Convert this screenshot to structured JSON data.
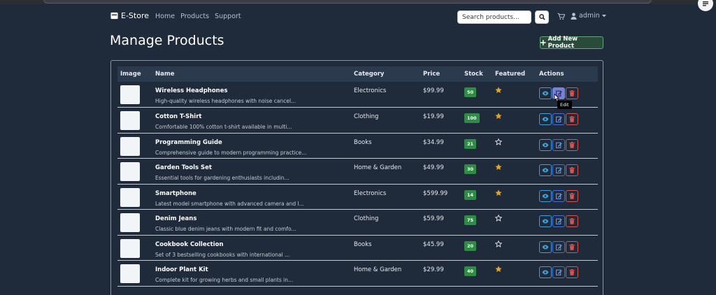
{
  "nav": {
    "brand": "E-Store",
    "links": [
      "Home",
      "Products",
      "Support"
    ],
    "search_placeholder": "Search products...",
    "user": "admin"
  },
  "page": {
    "title": "Manage Products",
    "add_label": "Add New Product",
    "tooltip": "Edit"
  },
  "table": {
    "headers": [
      "Image",
      "Name",
      "Category",
      "Price",
      "Stock",
      "Featured",
      "Actions"
    ],
    "rows": [
      {
        "name": "Wireless Headphones",
        "desc": "High-quality wireless headphones with noise cancel...",
        "category": "Electronics",
        "price": "$99.99",
        "stock": "50",
        "featured": true
      },
      {
        "name": "Cotton T-Shirt",
        "desc": "Comfortable 100% cotton t-shirt available in multi...",
        "category": "Clothing",
        "price": "$19.99",
        "stock": "100",
        "featured": true
      },
      {
        "name": "Programming Guide",
        "desc": "Comprehensive guide to modern programming practice...",
        "category": "Books",
        "price": "$34.99",
        "stock": "21",
        "featured": false
      },
      {
        "name": "Garden Tools Set",
        "desc": "Essential tools for gardening enthusiasts includin...",
        "category": "Home & Garden",
        "price": "$49.99",
        "stock": "30",
        "featured": true
      },
      {
        "name": "Smartphone",
        "desc": "Latest model smartphone with advanced camera and l...",
        "category": "Electronics",
        "price": "$599.99",
        "stock": "14",
        "featured": true
      },
      {
        "name": "Denim Jeans",
        "desc": "Classic blue denim jeans with modern fit and comfo...",
        "category": "Clothing",
        "price": "$59.99",
        "stock": "75",
        "featured": false
      },
      {
        "name": "Cookbook Collection",
        "desc": "Set of 3 bestselling cookbooks with international ...",
        "category": "Books",
        "price": "$45.99",
        "stock": "20",
        "featured": false
      },
      {
        "name": "Indoor Plant Kit",
        "desc": "Complete kit for growing herbs and small plants in...",
        "category": "Home & Garden",
        "price": "$29.99",
        "stock": "40",
        "featured": true
      }
    ]
  },
  "colors": {
    "background": "#1f2a3a",
    "header_row": "#2c3a4d",
    "stock_badge": "#2f8b46",
    "star": "#e0a72a",
    "view": "#3ca0d8",
    "edit": "#4a6fd4",
    "delete": "#d9534f"
  },
  "icons": {
    "brand": "box-icon",
    "search": "search-icon",
    "cart": "cart-icon",
    "user": "user-icon",
    "add": "plus-icon",
    "view": "eye-icon",
    "edit": "pencil-icon",
    "delete": "trash-icon",
    "featured": "star-icon"
  }
}
